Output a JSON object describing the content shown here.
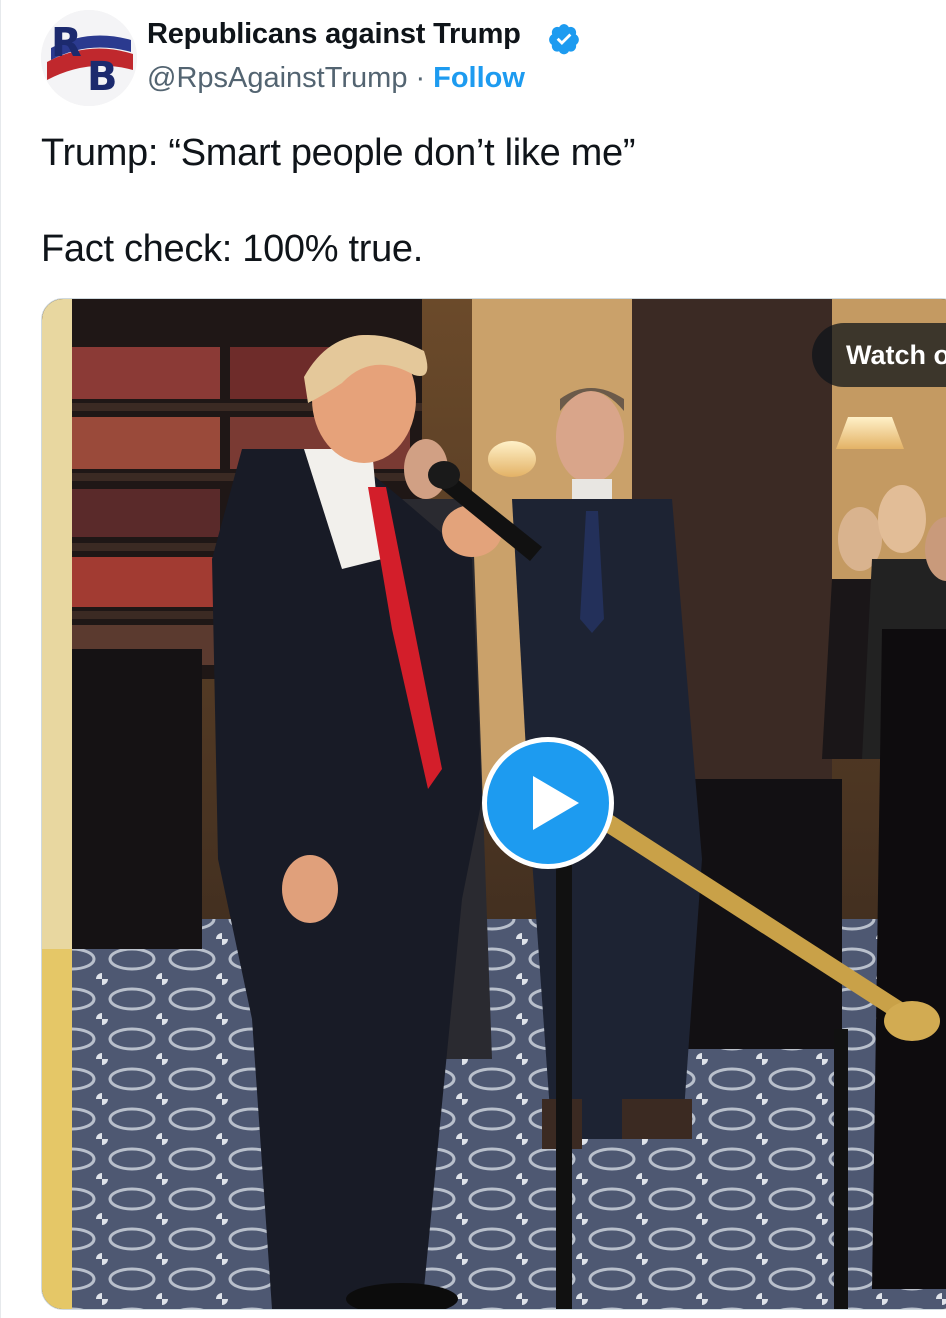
{
  "tweet": {
    "author": {
      "display_name": "Republicans against Trump",
      "handle": "@RpsAgainstTrump",
      "verified": true,
      "avatar_icon": "rb-logo-avatar",
      "avatar_letters": "RB"
    },
    "separator": "·",
    "follow_label": "Follow",
    "text_lines": [
      "Trump: “Smart people don’t like me”",
      "Fact check: 100% true."
    ],
    "media": {
      "type": "video",
      "watch_label": "Watch o",
      "play_icon": "play-icon"
    }
  },
  "colors": {
    "accent": "#1d9bf0",
    "text_primary": "#0f1419",
    "text_secondary": "#536471",
    "border": "#cfd9de"
  }
}
